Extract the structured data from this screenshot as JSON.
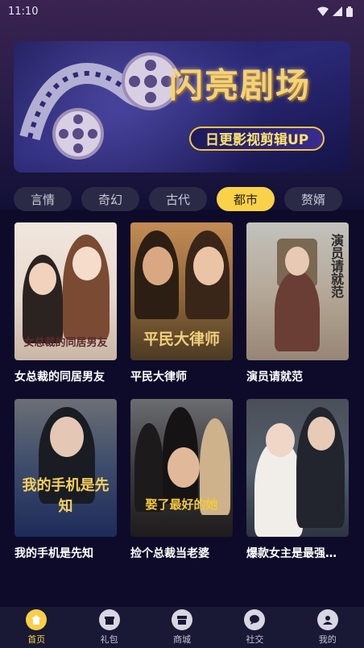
{
  "status_bar": {
    "time": "11:10"
  },
  "banner": {
    "title": "闪亮剧场",
    "subtitle": "日更影视剪辑UP"
  },
  "categories": [
    {
      "label": "言情",
      "active": false
    },
    {
      "label": "奇幻",
      "active": false
    },
    {
      "label": "古代",
      "active": false
    },
    {
      "label": "都市",
      "active": true
    },
    {
      "label": "赘婿",
      "active": false
    }
  ],
  "dramas": [
    {
      "title": "女总裁的同居男友",
      "poster_text": "女总裁的同居男友"
    },
    {
      "title": "平民大律师",
      "poster_text": "平民大律师"
    },
    {
      "title": "演员请就范",
      "poster_text": "演员请就范"
    },
    {
      "title": "我的手机是先知",
      "poster_text": "我的手机是先知"
    },
    {
      "title": "捡个总裁当老婆",
      "poster_text": "娶了最好的她"
    },
    {
      "title": "爆款女主是最强…",
      "poster_text": ""
    }
  ],
  "bottom_nav": [
    {
      "label": "首页",
      "icon": "home-icon",
      "active": true
    },
    {
      "label": "礼包",
      "icon": "gift-icon",
      "active": false
    },
    {
      "label": "商城",
      "icon": "shop-icon",
      "active": false
    },
    {
      "label": "社交",
      "icon": "chat-icon",
      "active": false
    },
    {
      "label": "我的",
      "icon": "profile-icon",
      "active": false
    }
  ],
  "colors": {
    "accent": "#fad249",
    "background": "#0e0b2a",
    "tab_bg": "#2a2a47"
  }
}
